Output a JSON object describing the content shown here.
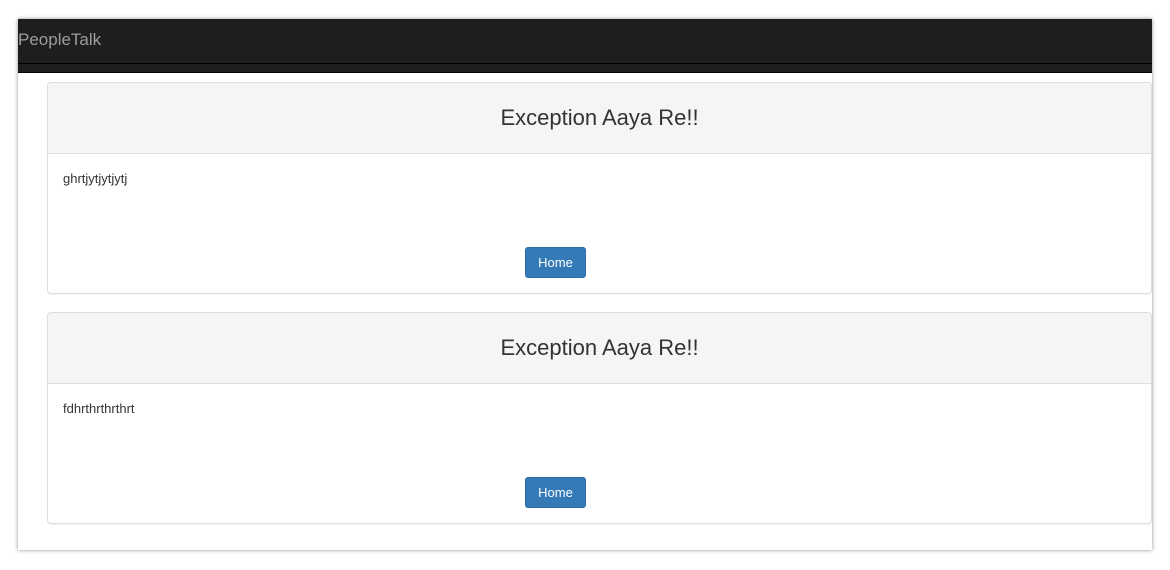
{
  "navbar": {
    "brand": "PeopleTalk"
  },
  "panels": [
    {
      "title": "Exception Aaya Re!!",
      "message": "ghrtjytjytjytj",
      "button_label": "Home"
    },
    {
      "title": "Exception Aaya Re!!",
      "message": "fdhrthrthrthrt",
      "button_label": "Home"
    }
  ],
  "colors": {
    "navbar": "#1e1e1e",
    "button": "#337ab7",
    "panel_heading": "#f5f5f5"
  }
}
